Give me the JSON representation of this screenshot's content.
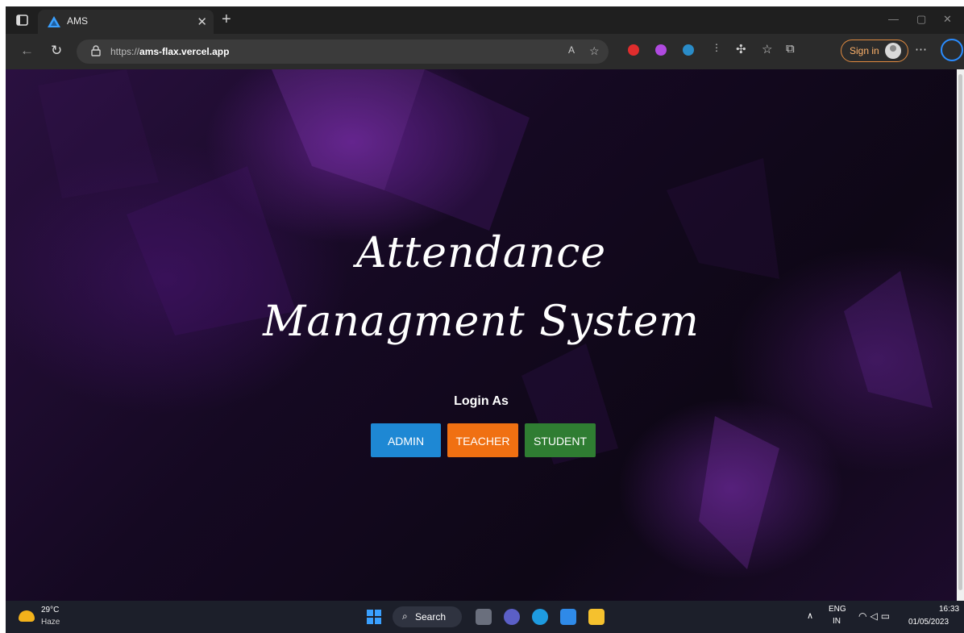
{
  "browser": {
    "tab_title": "AMS",
    "url_prefix": "https://",
    "url_host": "ams-flax.vercel.app",
    "signin_label": "Sign in"
  },
  "page": {
    "title_line1": "Attendance",
    "title_line2": "Managment System",
    "login_as": "Login As",
    "buttons": {
      "admin": "ADMIN",
      "teacher": "TEACHER",
      "student": "STUDENT"
    },
    "colors": {
      "admin": "#1e88d4",
      "teacher": "#f07012",
      "student": "#2f7d32"
    }
  },
  "taskbar": {
    "temperature": "29°C",
    "weather": "Haze",
    "search_label": "Search",
    "lang_line1": "ENG",
    "lang_line2": "IN",
    "time": "16:33",
    "date": "01/05/2023"
  }
}
